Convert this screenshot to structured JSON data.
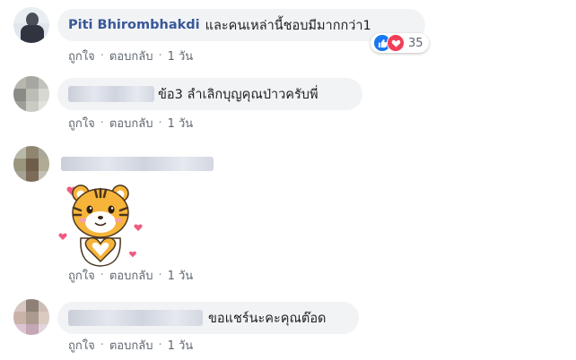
{
  "comments": [
    {
      "author": "Piti Bhirombhakdi",
      "text": "และคนเหล่านี้ชอบมีมากกว่า1",
      "reaction_count": "35",
      "actions": {
        "like": "ถูกใจ",
        "reply": "ตอบกลับ",
        "time": "1 วัน"
      }
    },
    {
      "text": "ข้อ3 ลำเลิกบุญคุณป่าวครับพี่",
      "actions": {
        "like": "ถูกใจ",
        "reply": "ตอบกลับ",
        "time": "1 วัน"
      }
    },
    {
      "sticker": "tiger-heart-sticker",
      "actions": {
        "like": "ถูกใจ",
        "reply": "ตอบกลับ",
        "time": "1 วัน"
      }
    },
    {
      "text": "ขอแชร์นะคะคุณต๊อด",
      "actions": {
        "like": "ถูกใจ",
        "reply": "ตอบกลับ",
        "time": "1 วัน"
      }
    }
  ],
  "meta_separator": "·",
  "reaction_icons": [
    "like-icon",
    "love-icon"
  ],
  "colors": {
    "name": "#385898",
    "bubble": "#f2f3f5",
    "meta": "#606770",
    "like": "#1877f2",
    "love": "#f33e58"
  }
}
